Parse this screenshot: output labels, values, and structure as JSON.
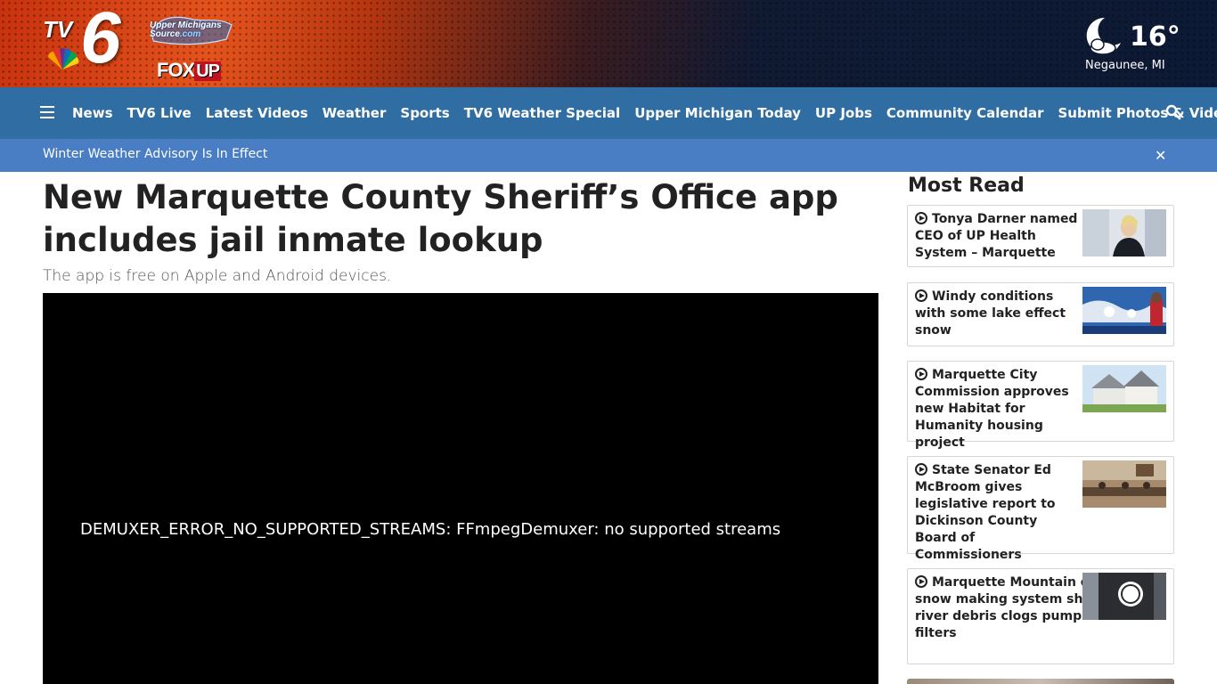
{
  "header": {
    "logo_tv": "TV",
    "logo_six": "6",
    "ums_line1": "Upper Michigans",
    "ums_line2": "Source",
    "ums_com": ".com",
    "foxup_fox": "FOX",
    "foxup_up": "UP",
    "weather": {
      "temp": "16°",
      "city": "Negaunee, MI",
      "icon": "moon-cloud-icon"
    }
  },
  "nav": {
    "items": [
      {
        "label": "News"
      },
      {
        "label": "TV6 Live"
      },
      {
        "label": "Latest Videos"
      },
      {
        "label": "Weather"
      },
      {
        "label": "Sports"
      },
      {
        "label": "TV6 Weather Special"
      },
      {
        "label": "Upper Michigan Today"
      },
      {
        "label": "UP Jobs"
      },
      {
        "label": "Community Calendar"
      },
      {
        "label": "Submit Photos & Videos"
      }
    ]
  },
  "alert": {
    "text": "Winter Weather Advisory Is In Effect",
    "close": "✕"
  },
  "article": {
    "headline": "New Marquette County Sheriff’s Office app includes jail inmate lookup",
    "subhead": "The app is free on Apple and Android devices.",
    "video_error": "DEMUXER_ERROR_NO_SUPPORTED_STREAMS: FFmpegDemuxer: no supported streams"
  },
  "sidebar": {
    "heading": "Most Read",
    "items": [
      {
        "title": "Tonya Darner named CEO of UP Health System – Marquette"
      },
      {
        "title": "Windy conditions with some lake effect snow"
      },
      {
        "title": "Marquette City Commission approves new Habitat for Humanity housing project"
      },
      {
        "title": "State Senator Ed McBroom gives legislative report to Dickinson County Board of Commissioners"
      },
      {
        "title": "Marquette Mountain experiences snow making system shutdown as river debris clogs pump house filters"
      }
    ]
  },
  "colors": {
    "nav_bg": "#2f6da3",
    "alert_bg": "#4a7ec4",
    "headline": "#222222"
  }
}
